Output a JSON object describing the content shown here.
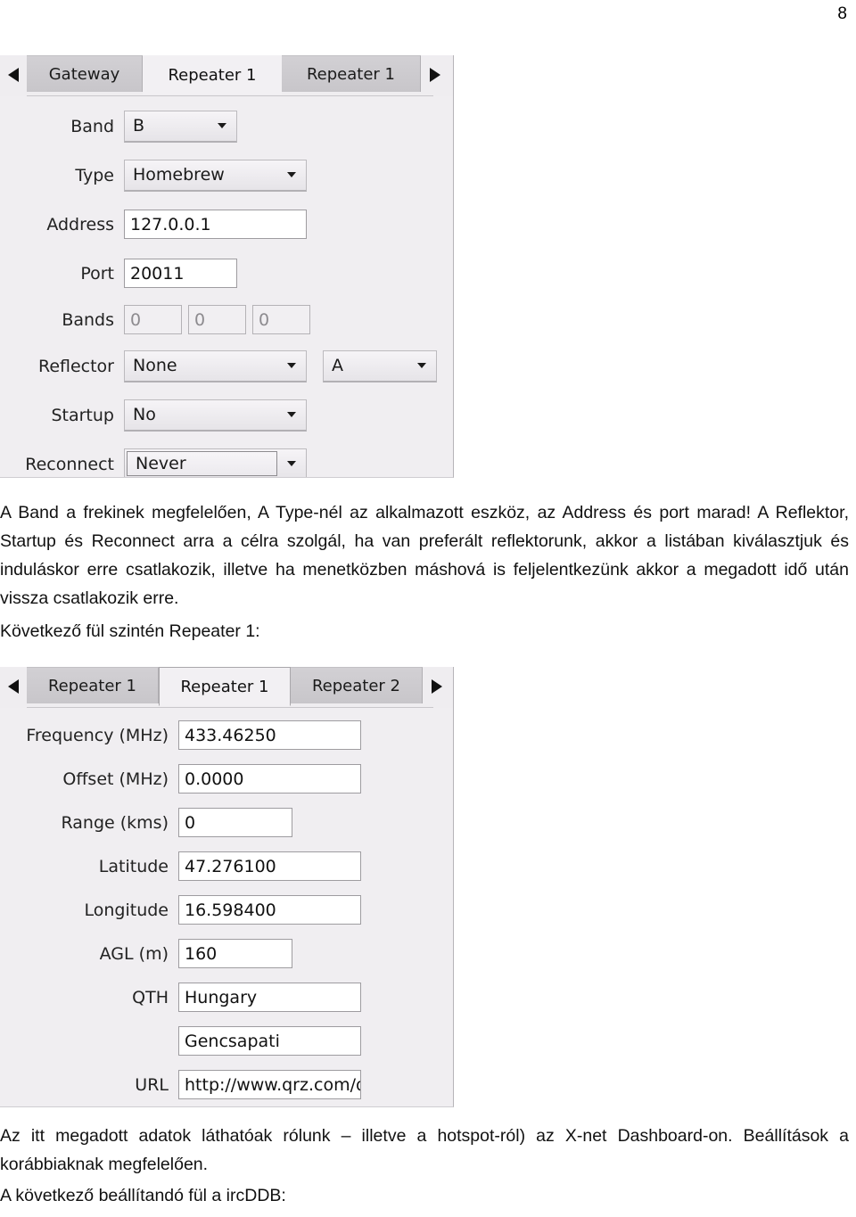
{
  "page": {
    "number": "8"
  },
  "screenshot_gateway": {
    "tabs": [
      {
        "label": "Gateway",
        "state": "inactive"
      },
      {
        "label": "Repeater 1",
        "state": "active"
      },
      {
        "label": "Repeater 1",
        "state": "inactive"
      }
    ],
    "nav": {
      "prev": "left-arrow",
      "next": "right-arrow"
    },
    "fields": {
      "band_label": "Band",
      "band_value": "B",
      "type_label": "Type",
      "type_value": "Homebrew",
      "address_label": "Address",
      "address_value": "127.0.0.1",
      "port_label": "Port",
      "port_value": "20011",
      "bands_label": "Bands",
      "bands_values": [
        "0",
        "0",
        "0"
      ],
      "reflector_label": "Reflector",
      "reflector_value": "None",
      "reflector_module": "A",
      "startup_label": "Startup",
      "startup_value": "No",
      "reconnect_label": "Reconnect",
      "reconnect_value": "Never"
    }
  },
  "screenshot_repeater": {
    "tabs": [
      {
        "label": "Repeater 1",
        "state": "inactive"
      },
      {
        "label": "Repeater 1",
        "state": "active"
      },
      {
        "label": "Repeater 2",
        "state": "inactive"
      }
    ],
    "nav": {
      "prev": "left-arrow",
      "next": "right-arrow"
    },
    "fields": {
      "frequency_label": "Frequency (MHz)",
      "frequency_value": "433.46250",
      "offset_label": "Offset (MHz)",
      "offset_value": "0.0000",
      "range_label": "Range (kms)",
      "range_value": "0",
      "latitude_label": "Latitude",
      "latitude_value": "47.276100",
      "longitude_label": "Longitude",
      "longitude_value": "16.598400",
      "agl_label": "AGL (m)",
      "agl_value": "160",
      "qth_label": "QTH",
      "qth_value": "Hungary",
      "qth_value2": "Gencsapati",
      "url_label": "URL",
      "url_value": "http://www.qrz.com/db"
    }
  },
  "text": {
    "paragraph1": "A Band a frekinek megfelelően, A Type-nél az alkalmazott eszköz, az Address és port marad! A Reflektor, Startup és Reconnect arra a célra szolgál, ha van preferált reflektorunk, akkor a listában kiválasztjuk és induláskor erre csatlakozik, illetve ha menetközben máshová is feljelentkezünk akkor a megadott idő után vissza csatlakozik erre.",
    "paragraph2": "Következő fül szintén Repeater 1:",
    "paragraph3": "Az itt megadott adatok láthatóak rólunk – illetve a hotspot-ról) az X-net Dashboard-on. Beállítások a korábbiaknak megfelelően.",
    "paragraph4": "A következő beállítandó fül a ircDDB:"
  }
}
